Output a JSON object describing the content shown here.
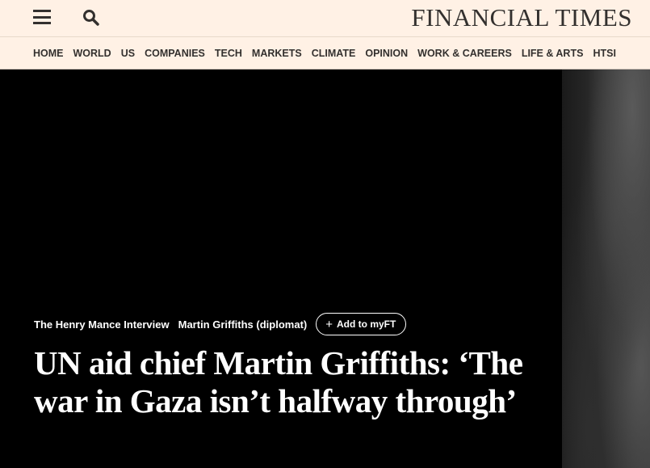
{
  "header": {
    "logo": "FINANCIAL TIMES"
  },
  "nav": {
    "items": [
      "HOME",
      "WORLD",
      "US",
      "COMPANIES",
      "TECH",
      "MARKETS",
      "CLIMATE",
      "OPINION",
      "WORK & CAREERS",
      "LIFE & ARTS",
      "HTSI"
    ]
  },
  "article": {
    "series": "The Henry Mance Interview",
    "topic": "Martin Griffiths (diplomat)",
    "myft_button": "Add to myFT",
    "headline": "UN aid chief Martin Griffiths: ‘The war in Gaza isn’t halfway through’"
  }
}
